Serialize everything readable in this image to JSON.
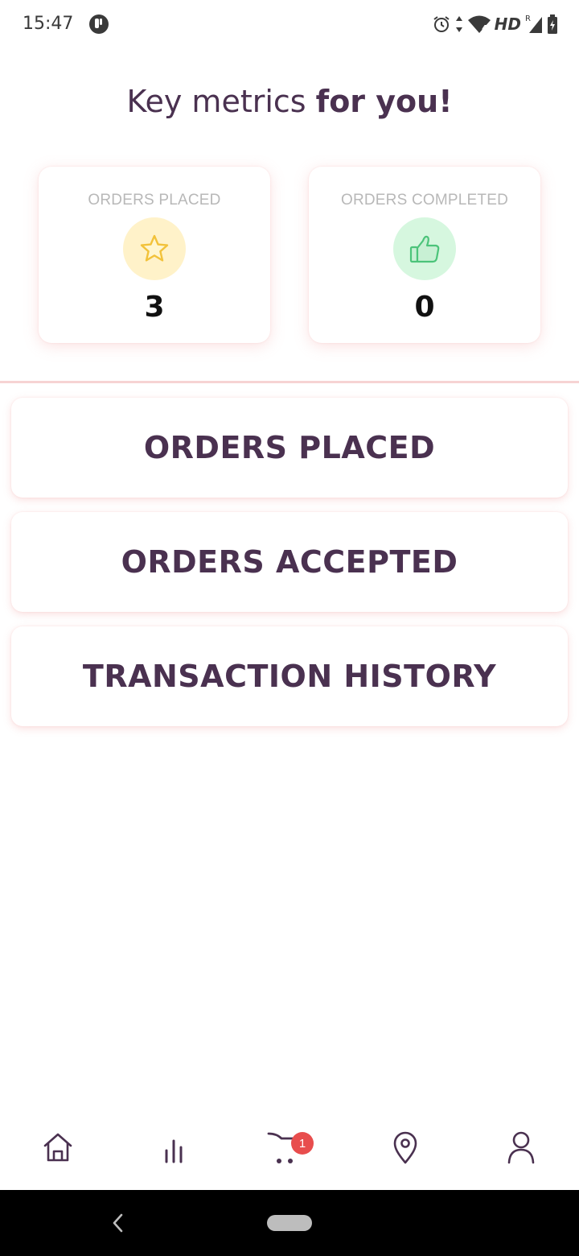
{
  "status_bar": {
    "time": "15:47",
    "network_label": "HD",
    "icons": [
      "app-notification-icon",
      "alarm-icon",
      "data-arrows-icon",
      "wifi-icon",
      "signal-icon",
      "battery-icon"
    ]
  },
  "heading": {
    "light": "Key metrics ",
    "bold": "for you!"
  },
  "metrics": [
    {
      "label": "ORDERS PLACED",
      "value": "3",
      "icon": "star-icon",
      "icon_bg": "#fff2c9",
      "icon_color": "#f2c23a"
    },
    {
      "label": "ORDERS COMPLETED",
      "value": "0",
      "icon": "thumbs-up-icon",
      "icon_bg": "#d6f7df",
      "icon_color": "#4cc47a"
    }
  ],
  "actions": {
    "orders_placed": "ORDERS PLACED",
    "orders_accepted": "ORDERS ACCEPTED",
    "transaction_history": "TRANSACTION HISTORY"
  },
  "bottom_nav": {
    "items": [
      "home-icon",
      "stats-icon",
      "cart-icon",
      "location-icon",
      "profile-icon"
    ],
    "cart_badge": "1"
  },
  "colors": {
    "brand": "#4a3150",
    "accent_shadow": "#f09696",
    "badge": "#e84d4d"
  }
}
